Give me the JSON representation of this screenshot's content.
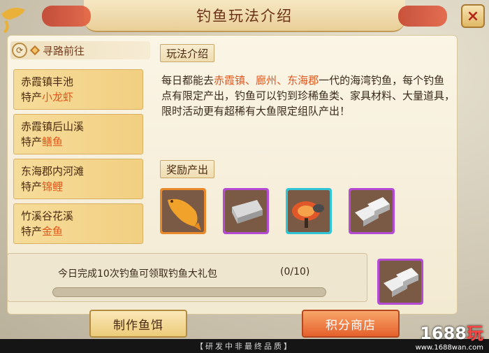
{
  "title": "钓鱼玩法介绍",
  "close_symbol": "×",
  "left": {
    "header": "寻路前往",
    "routes": [
      {
        "name": "赤霞镇丰池",
        "prefix": "特产",
        "fish": "小龙虾"
      },
      {
        "name": "赤霞镇后山溪",
        "prefix": "特产",
        "fish": "鳝鱼"
      },
      {
        "name": "东海郡内河滩",
        "prefix": "特产",
        "fish": "锦鲤"
      },
      {
        "name": "竹溪谷花溪",
        "prefix": "特产",
        "fish": "金鱼"
      }
    ]
  },
  "intro": {
    "label": "玩法介绍",
    "pre": "每日都能去",
    "place1": "赤霞镇",
    "sep1": "、",
    "place2": "廊州",
    "sep2": "、",
    "place3": "东海郡",
    "post": "一代的海湾钓鱼，每个钓鱼点有限定产出，钓鱼可以钓到珍稀鱼类、家具材料、大量道具，限时活动更有超稀有大鱼限定组队产出！"
  },
  "rewards": {
    "label": "奖励产出",
    "items": [
      {
        "icon": "golden-fish-icon",
        "frame": "orange"
      },
      {
        "icon": "silver-ingot-icon",
        "frame": "purple"
      },
      {
        "icon": "lingzhi-mushroom-icon",
        "frame": "cyan"
      },
      {
        "icon": "silver-bars-icon",
        "frame": "purple"
      }
    ]
  },
  "daily": {
    "text": "今日完成10次钓鱼可领取钓鱼大礼包",
    "count": "(0/10)",
    "progress": 0,
    "gift_icon": "silver-bars-icon"
  },
  "buttons": {
    "bait": "制作鱼饵",
    "shop": "积分商店"
  },
  "footer": "【研发中非最终品质】",
  "watermark": {
    "logo_num": "1688",
    "logo_char": "玩",
    "url": "www.1688wan.com"
  },
  "colors": {
    "highlight": "#e0571c",
    "title_text": "#6a3216",
    "orange_frame": "#e88a2c",
    "purple_frame": "#b64bd3",
    "cyan_frame": "#2fc4d6"
  }
}
